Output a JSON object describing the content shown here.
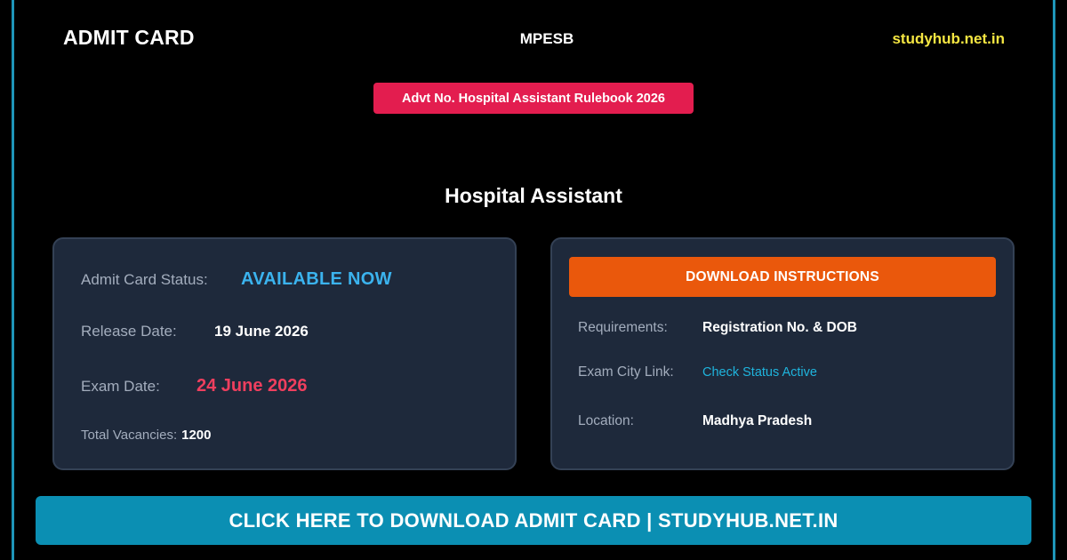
{
  "header": {
    "left_title": "ADMIT CARD",
    "center_org": "MPESB",
    "right_site": "studyhub.net.in"
  },
  "advt_badge": "Advt No. Hospital Assistant Rulebook 2026",
  "post_title": "Hospital Assistant",
  "left_panel": {
    "status_label": "Admit Card Status:",
    "status_value": "AVAILABLE NOW",
    "release_label": "Release Date:",
    "release_value": "19 June 2026",
    "exam_label": "Exam Date:",
    "exam_value": "24 June 2026",
    "vacancies_label": "Total Vacancies:",
    "vacancies_value": "1200"
  },
  "right_panel": {
    "button_label": "DOWNLOAD INSTRUCTIONS",
    "requirements_label": "Requirements:",
    "requirements_value": "Registration No. & DOB",
    "city_label": "Exam City Link:",
    "city_value": "Check Status Active",
    "location_label": "Location:",
    "location_value": "Madhya Pradesh"
  },
  "cta_label": "CLICK HERE TO DOWNLOAD ADMIT CARD | STUDYHUB.NET.IN",
  "colors": {
    "frame": "#1e95b8",
    "site_yellow": "#f5e642",
    "badge_red": "#e31d4f",
    "panel_bg": "#1e293b",
    "status_blue": "#3bb3ee",
    "exam_red": "#ef3f5e",
    "instr_orange": "#ea580c",
    "link_cyan": "#1fb4dd",
    "cta_blue": "#0b8fb3"
  }
}
